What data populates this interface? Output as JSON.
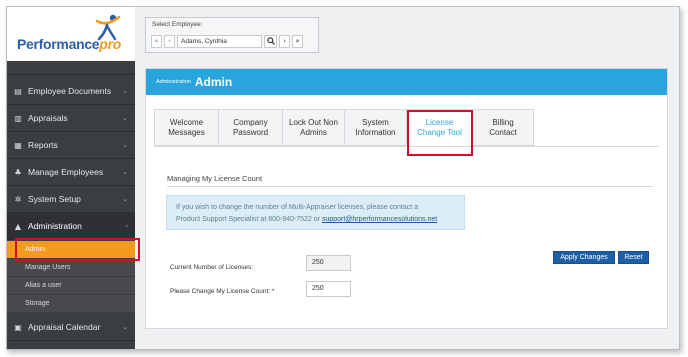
{
  "logo": {
    "text_main": "Performance",
    "text_accent": "pro"
  },
  "employee_selector": {
    "label": "Select Employee:",
    "value": "Adams, Cynthia",
    "nav_first": "«",
    "nav_prev": "‹",
    "nav_next": "›",
    "nav_last": "»"
  },
  "sidebar": {
    "items": [
      {
        "label": "Employee Documents",
        "icon": "document-icon"
      },
      {
        "label": "Appraisals",
        "icon": "appraisal-icon"
      },
      {
        "label": "Reports",
        "icon": "report-icon"
      },
      {
        "label": "Manage Employees",
        "icon": "users-icon"
      },
      {
        "label": "System Setup",
        "icon": "gear-icon"
      },
      {
        "label": "Administration",
        "icon": "admin-icon"
      },
      {
        "label": "Appraisal Calendar",
        "icon": "calendar-icon"
      }
    ],
    "sub_items": [
      {
        "label": "Admin"
      },
      {
        "label": "Manage Users"
      },
      {
        "label": "Alias a user"
      },
      {
        "label": "Storage"
      }
    ]
  },
  "panel": {
    "breadcrumb": "Administration",
    "title": "Admin",
    "tabs": [
      {
        "label": "Welcome Messages"
      },
      {
        "label": "Company Password"
      },
      {
        "label": "Lock Out Non Admins"
      },
      {
        "label": "System Information"
      },
      {
        "label": "License Change Tool"
      },
      {
        "label": "Billing Contact"
      }
    ],
    "section_title": "Managing My License Count",
    "info_text_1": "If you wish to change the number of Multi-Appraiser licenses, please contact a",
    "info_text_2": "Product Support Specialist at 800-940-7522 or",
    "info_email": "support@hrperformancesolutions.net",
    "current_label": "Current Number of Licenses:",
    "current_value": "250",
    "change_label": "Please Change My License Count: *",
    "change_value": "250",
    "apply_button": "Apply Changes",
    "reset_button": "Reset"
  },
  "colors": {
    "accent_blue": "#29a5dd",
    "sidebar_dark": "#3a3d41",
    "selected_orange": "#f39a1f",
    "highlight_red": "#d0102a",
    "button_blue": "#1d5fa6"
  }
}
